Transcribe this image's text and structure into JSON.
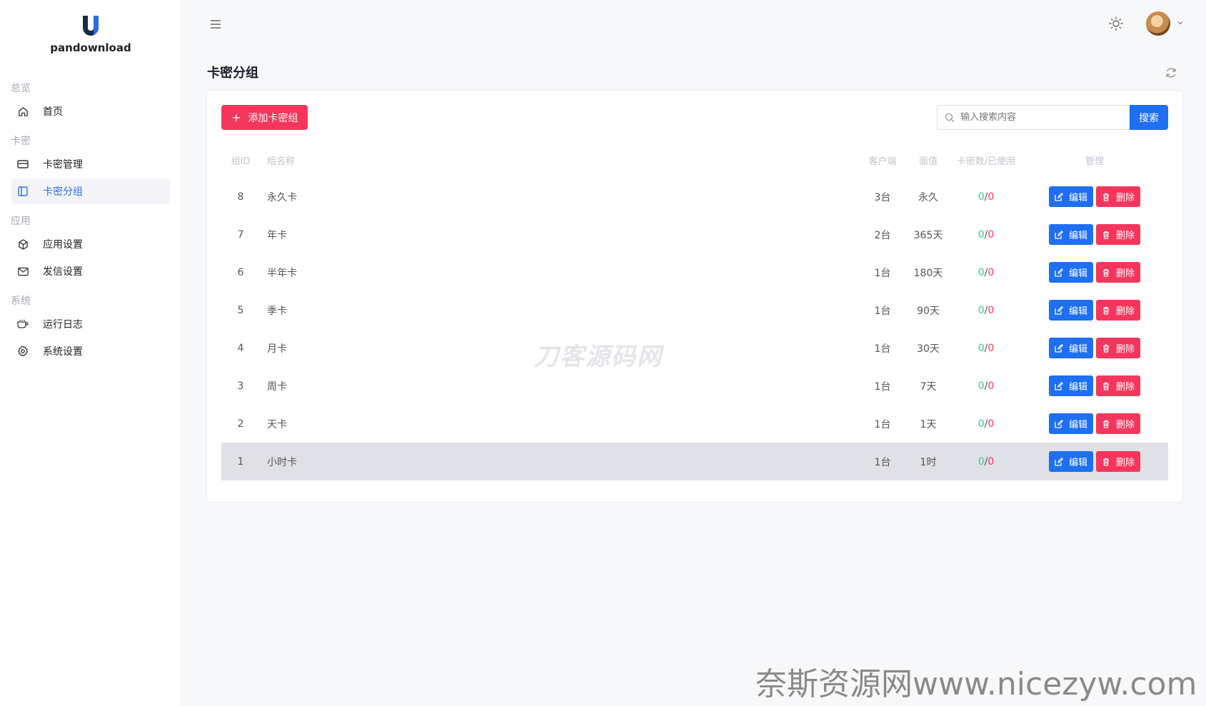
{
  "app": {
    "brand": "pandownload"
  },
  "sidebar": {
    "groups": [
      {
        "title": "总览",
        "items": [
          {
            "label": "首页",
            "icon": "home-icon"
          }
        ]
      },
      {
        "title": "卡密",
        "items": [
          {
            "label": "卡密管理",
            "icon": "card-icon"
          },
          {
            "label": "卡密分组",
            "icon": "sidebar-panel-icon",
            "active": true
          }
        ]
      },
      {
        "title": "应用",
        "items": [
          {
            "label": "应用设置",
            "icon": "cube-icon"
          },
          {
            "label": "发信设置",
            "icon": "mail-icon"
          }
        ]
      },
      {
        "title": "系统",
        "items": [
          {
            "label": "运行日志",
            "icon": "cup-icon"
          },
          {
            "label": "系统设置",
            "icon": "gear-icon"
          }
        ]
      }
    ]
  },
  "page": {
    "title": "卡密分组"
  },
  "toolbar": {
    "add_label": "添加卡密组",
    "search_placeholder": "输入搜索内容",
    "search_label": "搜索"
  },
  "table": {
    "headers": {
      "id": "组ID",
      "name": "组名称",
      "client": "客户端",
      "value": "面值",
      "count": "卡密数/已使用",
      "manage": "管理"
    },
    "edit_label": "编辑",
    "delete_label": "删除",
    "rows": [
      {
        "id": "8",
        "name": "永久卡",
        "client": "3台",
        "value": "永久",
        "total": "0",
        "used": "0"
      },
      {
        "id": "7",
        "name": "年卡",
        "client": "2台",
        "value": "365天",
        "total": "0",
        "used": "0"
      },
      {
        "id": "6",
        "name": "半年卡",
        "client": "1台",
        "value": "180天",
        "total": "0",
        "used": "0"
      },
      {
        "id": "5",
        "name": "季卡",
        "client": "1台",
        "value": "90天",
        "total": "0",
        "used": "0"
      },
      {
        "id": "4",
        "name": "月卡",
        "client": "1台",
        "value": "30天",
        "total": "0",
        "used": "0"
      },
      {
        "id": "3",
        "name": "周卡",
        "client": "1台",
        "value": "7天",
        "total": "0",
        "used": "0"
      },
      {
        "id": "2",
        "name": "天卡",
        "client": "1台",
        "value": "1天",
        "total": "0",
        "used": "0"
      },
      {
        "id": "1",
        "name": "小时卡",
        "client": "1台",
        "value": "1时",
        "total": "0",
        "used": "0"
      }
    ]
  },
  "watermarks": {
    "center": "刀客源码网",
    "bottom": "奈斯资源网www.nicezyw.com"
  },
  "colors": {
    "primary": "#1e6ff1",
    "danger": "#f5365c",
    "success": "#2dce89",
    "active_nav": "#2f6ce5"
  }
}
